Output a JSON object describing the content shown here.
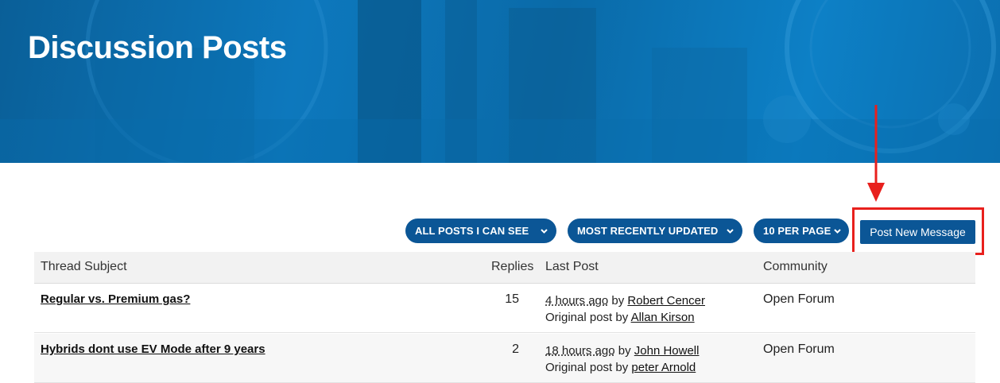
{
  "header": {
    "title": "Discussion Posts"
  },
  "toolbar": {
    "filter_label": "ALL POSTS I CAN SEE",
    "sort_label": "MOST RECENTLY UPDATED",
    "per_page_label": "10 PER PAGE",
    "post_button_label": "Post New Message"
  },
  "table": {
    "columns": [
      "Thread Subject",
      "Replies",
      "Last Post",
      "Community"
    ],
    "rows": [
      {
        "subject": "Regular vs. Premium gas?",
        "replies": "15",
        "time": "4 hours ago",
        "by_word": "by",
        "last_author": "Robert Cencer",
        "original_label": "Original post by",
        "original_author": "Allan Kirson",
        "community": "Open Forum"
      },
      {
        "subject": "Hybrids dont use EV Mode after 9 years",
        "replies": "2",
        "time": "18 hours ago",
        "by_word": "by",
        "last_author": "John Howell",
        "original_label": "Original post by",
        "original_author": "peter Arnold",
        "community": "Open Forum"
      }
    ]
  },
  "colors": {
    "brand_blue": "#0b5696",
    "highlight_red": "#e8201d"
  }
}
